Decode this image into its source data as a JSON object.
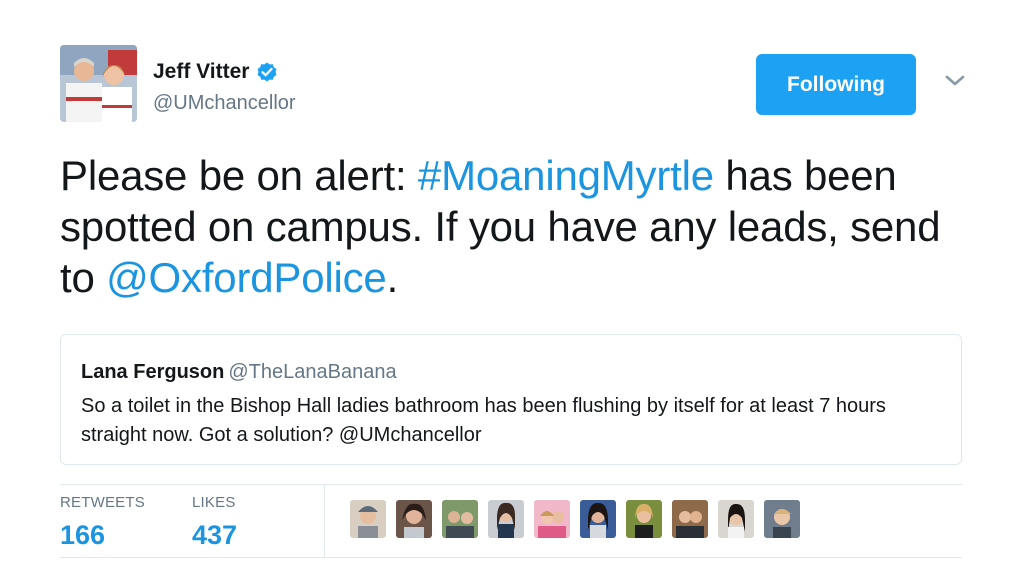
{
  "author": {
    "display_name": "Jeff Vitter",
    "handle": "@UMchancellor",
    "verified": true
  },
  "follow_button": {
    "label": "Following"
  },
  "tweet": {
    "parts": [
      "Please be on alert: ",
      "#MoaningMyrtle",
      " has been spotted on campus.  If you have any leads, send to ",
      "@OxfordPolice",
      "."
    ]
  },
  "quoted_tweet": {
    "display_name": "Lana Ferguson",
    "handle": "@TheLanaBanana",
    "text": "So a toilet in the Bishop Hall ladies bathroom has been flushing by itself for at least 7 hours straight now. Got a solution? @UMchancellor"
  },
  "stats": {
    "retweets_label": "RETWEETS",
    "retweets_value": "166",
    "likes_label": "LIKES",
    "likes_value": "437"
  },
  "colors": {
    "accent": "#1da1f2",
    "link": "#1b95e0",
    "secondary_text": "#657786",
    "border": "#e1e8ed"
  },
  "icons": {
    "verified": "verified-badge-icon",
    "menu": "chevron-down-icon"
  }
}
